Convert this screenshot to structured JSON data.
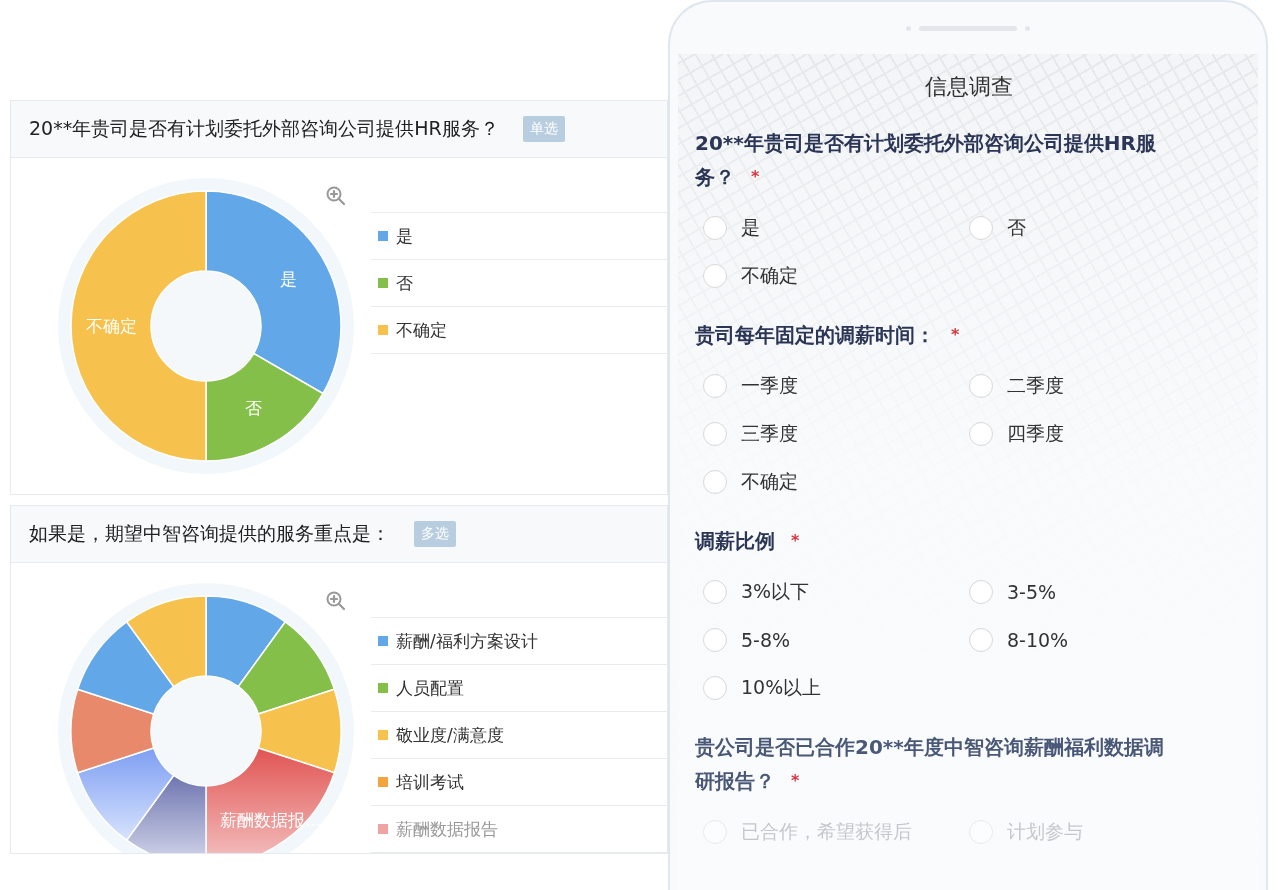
{
  "report_cards": [
    {
      "question": "20**年贵司是否有计划委托外部咨询公司提供HR服务？",
      "badge": "单选",
      "slice_labels": [
        {
          "text": "是"
        },
        {
          "text": "否"
        },
        {
          "text": "不确定"
        }
      ],
      "legend": [
        {
          "label": "是",
          "color": "#62a8e8",
          "faded": false
        },
        {
          "label": "否",
          "color": "#84bf4a",
          "faded": false
        },
        {
          "label": "不确定",
          "color": "#f6c24d",
          "faded": false
        }
      ]
    },
    {
      "question": "如果是，期望中智咨询提供的服务重点是：",
      "badge": "多选",
      "slice_labels": [
        {
          "text": "薪酬数据报..."
        }
      ],
      "legend": [
        {
          "label": "薪酬/福利方案设计",
          "color": "#62a8e8",
          "faded": false
        },
        {
          "label": "人员配置",
          "color": "#84bf4a",
          "faded": false
        },
        {
          "label": "敬业度/满意度",
          "color": "#f6c24d",
          "faded": false
        },
        {
          "label": "培训考试",
          "color": "#f3a43c",
          "faded": false
        },
        {
          "label": "薪酬数据报告",
          "color": "#f0a3a3",
          "faded": true
        }
      ]
    }
  ],
  "phone": {
    "title": "信息调查",
    "questions": [
      {
        "text": "20**年贵司是否有计划委托外部咨询公司提供HR服务？",
        "required_mark": "*",
        "faded": false,
        "options": [
          {
            "label": "是",
            "selected": false
          },
          {
            "label": "否",
            "selected": false
          },
          {
            "label": "不确定",
            "selected": false
          }
        ]
      },
      {
        "text": "贵司每年固定的调薪时间：",
        "required_mark": "*",
        "faded": false,
        "options": [
          {
            "label": "一季度",
            "selected": false
          },
          {
            "label": "二季度",
            "selected": false
          },
          {
            "label": "三季度",
            "selected": false
          },
          {
            "label": "四季度",
            "selected": false
          },
          {
            "label": "不确定",
            "selected": false
          }
        ]
      },
      {
        "text": "调薪比例",
        "required_mark": "*",
        "faded": false,
        "options": [
          {
            "label": "3%以下",
            "selected": false
          },
          {
            "label": "3-5%",
            "selected": false
          },
          {
            "label": "5-8%",
            "selected": false
          },
          {
            "label": "8-10%",
            "selected": false
          },
          {
            "label": "10%以上",
            "selected": false
          }
        ]
      },
      {
        "text": "贵公司是否已合作20**年度中智咨询薪酬福利数据调研报告？",
        "required_mark": "*",
        "faded": true,
        "options": [
          {
            "label": "已合作，希望获得后",
            "selected": false
          },
          {
            "label": "计划参与",
            "selected": false
          }
        ]
      }
    ]
  }
}
